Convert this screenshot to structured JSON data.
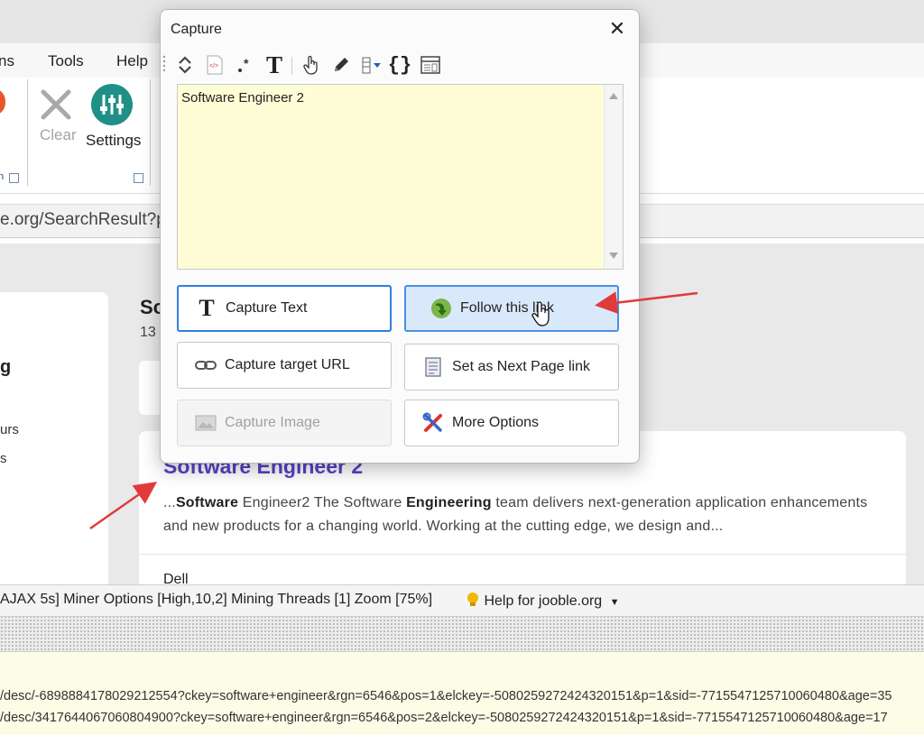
{
  "menubar": {
    "items": [
      "ns",
      "Tools",
      "Help"
    ]
  },
  "ribbon": {
    "clear_label": "Clear",
    "settings_label": "Settings",
    "group_label_fragment": "n"
  },
  "address_bar": {
    "url_fragment": "e.org/SearchResult?p"
  },
  "page": {
    "heading_fragment": "So",
    "count_fragment": "13",
    "left_fragments": [
      "g",
      "urs",
      "s"
    ],
    "result": {
      "title": "Software Engineer 2",
      "snippet_pre": "...",
      "snippet_b1": "Software",
      "snippet_mid": " Engineer2 The Software ",
      "snippet_b2": "Engineering",
      "snippet_post": " team delivers next-generation application enhancements and new products for a changing world. Working at the cutting edge, we design and...",
      "company_fragment": "Dell"
    }
  },
  "statusbar": {
    "text": "AJAX 5s] Miner Options [High,10,2] Mining Threads [1] Zoom [75%]",
    "help_link": "Help for jooble.org"
  },
  "log": {
    "lines": [
      "/desc/-6898884178029212554?ckey=software+engineer&rgn=6546&pos=1&elckey=-5080259272424320151&p=1&sid=-7715547125710060480&age=35",
      "/desc/3417644067060804900?ckey=software+engineer&rgn=6546&pos=2&elckey=-5080259272424320151&p=1&sid=-7715547125710060480&age=17"
    ]
  },
  "dialog": {
    "title": "Capture",
    "textarea_value": "Software Engineer 2",
    "buttons": {
      "capture_text": "Capture Text",
      "follow_link": "Follow this link",
      "capture_target_url": "Capture target URL",
      "set_next_page": "Set as Next Page link",
      "capture_image": "Capture Image",
      "more_options": "More Options"
    },
    "toolbar_icons": [
      "grip-icon",
      "expand-collapse-icon",
      "html-tag-icon",
      "regex-icon",
      "text-icon",
      "hand-icon",
      "pencil-icon",
      "column-dropdown-icon",
      "braces-icon",
      "table-icon"
    ]
  },
  "colors": {
    "highlight_button_bg": "#d9e9fb",
    "focus_border": "#2f7fe0",
    "textarea_bg": "#fffdd6",
    "link_title": "#5b3fc8",
    "annotation_arrow": "#e03b3b",
    "log_bg": "#fdfce6"
  }
}
